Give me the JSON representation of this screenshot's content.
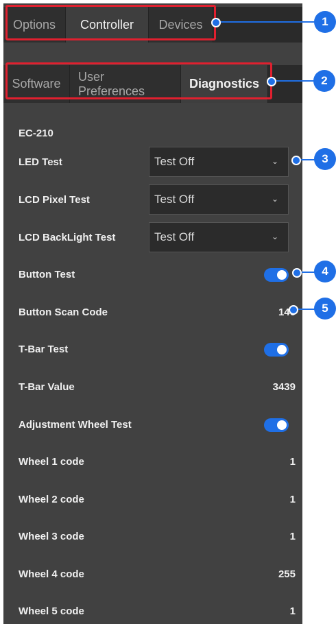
{
  "tabs": [
    "Options",
    "Controller",
    "Devices"
  ],
  "active_tab": 1,
  "subtabs": [
    "Software",
    "User Preferences",
    "Diagnostics"
  ],
  "active_subtab": 2,
  "device": "EC-210",
  "rows": {
    "led_test": {
      "label": "LED Test",
      "value": "Test Off"
    },
    "lcd_pixel_test": {
      "label": "LCD Pixel Test",
      "value": "Test Off"
    },
    "lcd_backlight_test": {
      "label": "LCD BackLight Test",
      "value": "Test Off"
    },
    "button_test": {
      "label": "Button Test",
      "on": true
    },
    "button_scan_code": {
      "label": "Button Scan Code",
      "value": "146"
    },
    "tbar_test": {
      "label": "T-Bar Test",
      "on": true
    },
    "tbar_value": {
      "label": "T-Bar Value",
      "value": "3439"
    },
    "adjustment_wheel_test": {
      "label": "Adjustment Wheel Test",
      "on": true
    },
    "wheel_1": {
      "label": "Wheel 1 code",
      "value": "1"
    },
    "wheel_2": {
      "label": "Wheel 2 code",
      "value": "1"
    },
    "wheel_3": {
      "label": "Wheel 3 code",
      "value": "1"
    },
    "wheel_4": {
      "label": "Wheel 4 code",
      "value": "255"
    },
    "wheel_5": {
      "label": "Wheel 5 code",
      "value": "1"
    }
  },
  "callouts": [
    "1",
    "2",
    "3",
    "4",
    "5"
  ],
  "colors": {
    "accent": "#1f6fe6",
    "highlight": "#e0202f",
    "panel": "#414141"
  }
}
